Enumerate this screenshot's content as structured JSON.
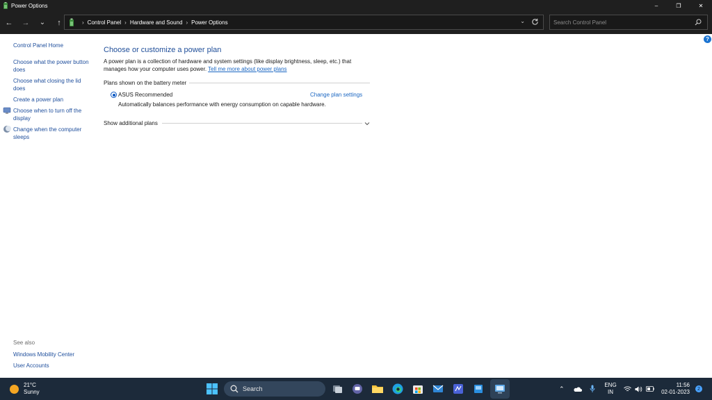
{
  "window": {
    "title": "Power Options",
    "controls": {
      "minimize": "–",
      "restore": "❐",
      "close": "✕"
    }
  },
  "nav": {
    "back": "←",
    "forward": "→",
    "recent": "⌄",
    "up": "↑",
    "breadcrumb": [
      "Control Panel",
      "Hardware and Sound",
      "Power Options"
    ],
    "search_placeholder": "Search Control Panel"
  },
  "sidebar": {
    "home": "Control Panel Home",
    "links": [
      "Choose what the power button does",
      "Choose what closing the lid does",
      "Create a power plan",
      "Choose when to turn off the display",
      "Change when the computer sleeps"
    ],
    "see_also_title": "See also",
    "see_also": [
      "Windows Mobility Center",
      "User Accounts"
    ]
  },
  "main": {
    "heading": "Choose or customize a power plan",
    "description": "A power plan is a collection of hardware and system settings (like display brightness, sleep, etc.) that manages how your computer uses power.",
    "description_link": "Tell me more about power plans",
    "group_label": "Plans shown on the battery meter",
    "plan": {
      "name": "ASUS Recommended",
      "selected": true,
      "change_link": "Change plan settings",
      "description": "Automatically balances performance with energy consumption on capable hardware."
    },
    "show_additional": "Show additional plans",
    "help": "?"
  },
  "taskbar": {
    "weather_temp": "21°C",
    "weather_desc": "Sunny",
    "search_label": "Search",
    "language": "ENG",
    "region": "IN",
    "time": "11:56",
    "date": "02-01-2023",
    "notification_count": "2"
  },
  "colors": {
    "titlebar": "#1f1f1f",
    "link": "#1e4e9c",
    "heading": "#1f4e99",
    "accent": "#0a57c2",
    "taskbar": "#1c2a3a"
  }
}
